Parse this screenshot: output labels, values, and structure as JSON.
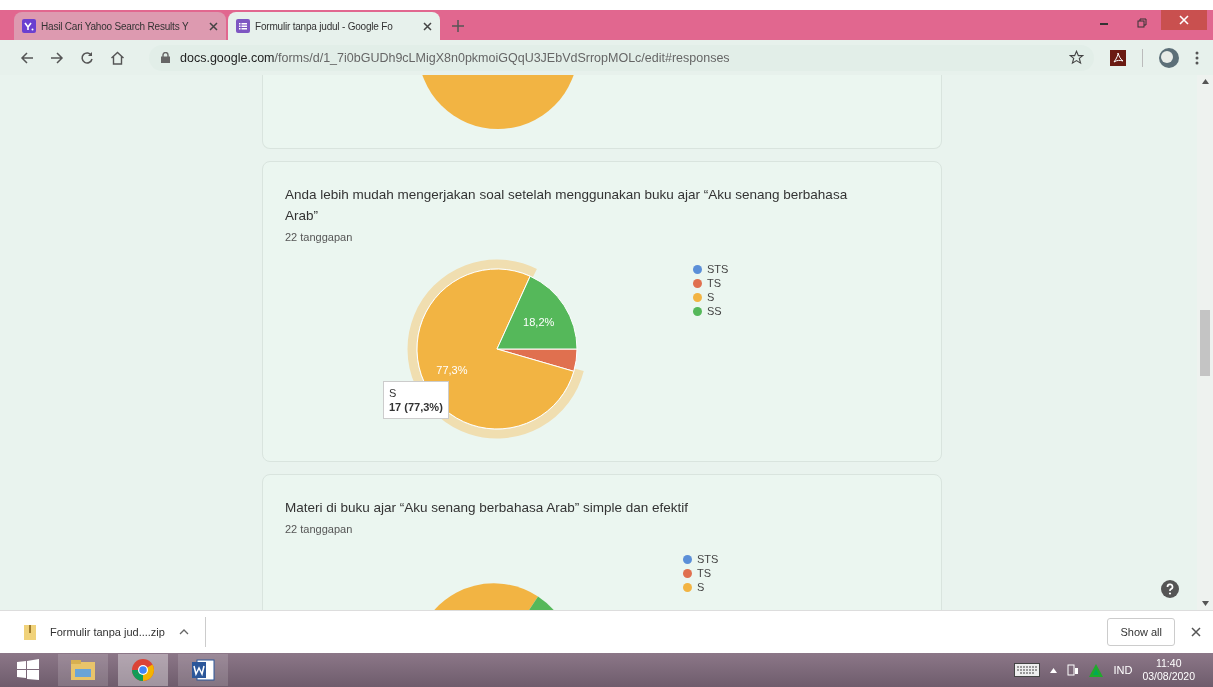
{
  "browser": {
    "tabs": [
      {
        "title": "Hasil Cari Yahoo Search Results Y",
        "kind": "yahoo",
        "selected": false
      },
      {
        "title": "Formulir tanpa judul - Google Fo",
        "kind": "forms",
        "selected": true
      }
    ],
    "address": {
      "host": "docs.google.com",
      "path": "/forms/d/1_7i0bGUDh9cLMigX8n0pkmoiGQqU3JEbVdSrropMOLc/edit#responses"
    }
  },
  "questions": [
    {
      "title": "Anda lebih mudah mengerjakan soal setelah menggunakan buku ajar “Aku senang berbahasa Arab”",
      "responses": "22 tanggapan",
      "chart_data": {
        "type": "pie",
        "categories": [
          "STS",
          "TS",
          "S",
          "SS"
        ],
        "values": [
          0,
          4.5,
          77.3,
          18.2
        ],
        "colors": [
          "#5b8fd8",
          "#e0704f",
          "#f2b443",
          "#55b85a"
        ],
        "value_labels": [
          null,
          null,
          "77,3%",
          "18,2%"
        ],
        "legend": "right"
      },
      "slices": [
        {
          "selected": false
        },
        {
          "selected": false
        },
        {
          "selected": true
        },
        {
          "selected": false
        }
      ],
      "tooltip": {
        "title": "S",
        "value": "17 (77,3%)"
      }
    },
    {
      "title": "Materi di buku ajar “Aku senang berbahasa Arab” simple dan efektif",
      "responses": "22 tanggapan",
      "legend": [
        {
          "label": "STS",
          "color": "#5b8fd8"
        },
        {
          "label": "TS",
          "color": "#e0704f"
        },
        {
          "label": "S",
          "color": "#f2b443"
        }
      ]
    }
  ],
  "downloads": [
    {
      "name": "Formulir tanpa jud....zip"
    }
  ],
  "download_bar": {
    "show_all": "Show all"
  },
  "taskbar": {
    "apps": [
      {
        "kind": "explorer",
        "selected": false
      },
      {
        "kind": "chrome",
        "selected": true
      },
      {
        "kind": "word",
        "selected": false
      }
    ],
    "language": "IND",
    "time": "11:40",
    "date": "03/08/2020"
  }
}
